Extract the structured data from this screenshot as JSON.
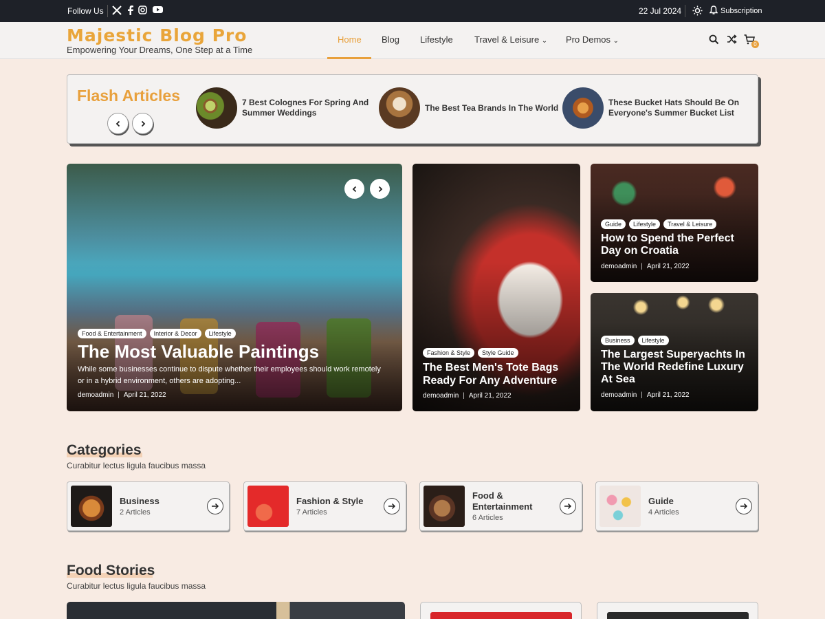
{
  "topbar": {
    "follow": "Follow Us",
    "date": "22 Jul 2024",
    "subscription": "Subscription"
  },
  "header": {
    "brand": "Majestic Blog Pro",
    "tagline": "Empowering Your Dreams, One Step at a Time",
    "nav": [
      "Home",
      "Blog",
      "Lifestyle",
      "Travel & Leisure",
      "Pro Demos"
    ],
    "cart_count": "0"
  },
  "flash": {
    "title": "Flash Articles",
    "items": [
      {
        "title_line1": "7 Best Colognes For Spring And",
        "title_line2": "Summer Weddings"
      },
      {
        "title_line1": "The Best Tea Brands In The World",
        "title_line2": ""
      },
      {
        "title_line1": "These Bucket Hats Should Be On",
        "title_line2": "Everyone's Summer Bucket List"
      }
    ]
  },
  "main_post": {
    "tags": [
      "Food & Entertainment",
      "Interior & Decor",
      "Lifestyle"
    ],
    "title": "The Most Valuable Paintings",
    "excerpt_line1": "While some businesses continue to dispute whether their employees should work remotely",
    "excerpt_line2": "or in a hybrid environment, others are adopting...",
    "author": "demoadmin",
    "date": "April 21, 2022"
  },
  "post2": {
    "tags": [
      "Fashion & Style",
      "Style Guide"
    ],
    "title_line1": "The Best Men's Tote Bags",
    "title_line2": "Ready For Any Adventure",
    "author": "demoadmin",
    "date": "April 21, 2022"
  },
  "post3": {
    "tags": [
      "Guide",
      "Lifestyle",
      "Travel & Leisure"
    ],
    "title_line1": "How to Spend the Perfect",
    "title_line2": "Day on Croatia",
    "author": "demoadmin",
    "date": "April 21, 2022"
  },
  "post4": {
    "tags": [
      "Business",
      "Lifestyle"
    ],
    "title_line1": "The Largest Superyachts In",
    "title_line2": "The World Redefine Luxury",
    "title_line3": "At Sea",
    "author": "demoadmin",
    "date": "April 21, 2022"
  },
  "categories": {
    "title": "Categories",
    "subtitle": "Curabitur lectus ligula faucibus massa",
    "items": [
      {
        "name_line1": "Business",
        "name_line2": "",
        "count": "2 Articles"
      },
      {
        "name_line1": "Fashion & Style",
        "name_line2": "",
        "count": "7 Articles"
      },
      {
        "name_line1": "Food &",
        "name_line2": "Entertainment",
        "count": "6 Articles"
      },
      {
        "name_line1": "Guide",
        "name_line2": "",
        "count": "4 Articles"
      }
    ]
  },
  "food_stories": {
    "title": "Food Stories",
    "subtitle": "Curabitur lectus ligula faucibus massa"
  },
  "colors": {
    "accent": "#e8a03c",
    "topbar": "#1e2128",
    "page_bg": "#f8ebe3"
  }
}
